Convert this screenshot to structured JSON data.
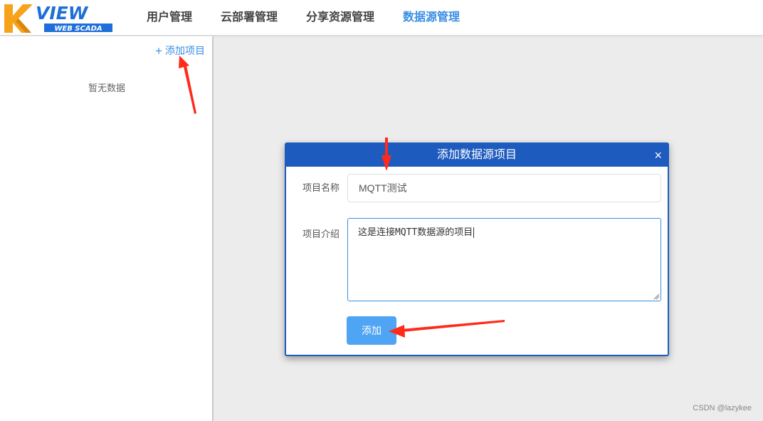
{
  "logo": {
    "text": "VIEW",
    "subtext": "WEB SCADA"
  },
  "nav": {
    "items": [
      {
        "label": "用户管理"
      },
      {
        "label": "云部署管理"
      },
      {
        "label": "分享资源管理"
      },
      {
        "label": "数据源管理"
      }
    ],
    "active_index": 3
  },
  "sidebar": {
    "add_label": "添加项目",
    "empty_text": "暂无数据"
  },
  "modal": {
    "title": "添加数据源项目",
    "close_glyph": "×",
    "name_label": "项目名称",
    "name_value": "MQTT测试",
    "desc_label": "项目介绍",
    "desc_value": "这是连接MQTT数据源的项目",
    "submit_label": "添加"
  },
  "watermark": "CSDN @lazykee",
  "colors": {
    "accent": "#3a8ee6",
    "modal_header": "#1e5bbf",
    "button": "#4fa4f3",
    "annotation_arrow": "#ff2a1a",
    "logo_orange": "#f7a21b",
    "logo_blue": "#1e6fd9"
  }
}
